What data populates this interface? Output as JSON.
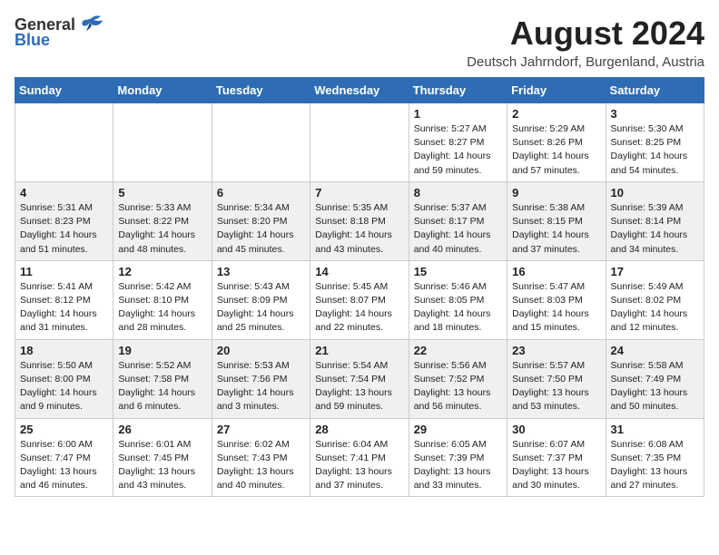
{
  "header": {
    "logo_general": "General",
    "logo_blue": "Blue",
    "month_year": "August 2024",
    "location": "Deutsch Jahrndorf, Burgenland, Austria"
  },
  "days_of_week": [
    "Sunday",
    "Monday",
    "Tuesday",
    "Wednesday",
    "Thursday",
    "Friday",
    "Saturday"
  ],
  "weeks": [
    [
      {
        "day": "",
        "detail": ""
      },
      {
        "day": "",
        "detail": ""
      },
      {
        "day": "",
        "detail": ""
      },
      {
        "day": "",
        "detail": ""
      },
      {
        "day": "1",
        "detail": "Sunrise: 5:27 AM\nSunset: 8:27 PM\nDaylight: 14 hours\nand 59 minutes."
      },
      {
        "day": "2",
        "detail": "Sunrise: 5:29 AM\nSunset: 8:26 PM\nDaylight: 14 hours\nand 57 minutes."
      },
      {
        "day": "3",
        "detail": "Sunrise: 5:30 AM\nSunset: 8:25 PM\nDaylight: 14 hours\nand 54 minutes."
      }
    ],
    [
      {
        "day": "4",
        "detail": "Sunrise: 5:31 AM\nSunset: 8:23 PM\nDaylight: 14 hours\nand 51 minutes."
      },
      {
        "day": "5",
        "detail": "Sunrise: 5:33 AM\nSunset: 8:22 PM\nDaylight: 14 hours\nand 48 minutes."
      },
      {
        "day": "6",
        "detail": "Sunrise: 5:34 AM\nSunset: 8:20 PM\nDaylight: 14 hours\nand 45 minutes."
      },
      {
        "day": "7",
        "detail": "Sunrise: 5:35 AM\nSunset: 8:18 PM\nDaylight: 14 hours\nand 43 minutes."
      },
      {
        "day": "8",
        "detail": "Sunrise: 5:37 AM\nSunset: 8:17 PM\nDaylight: 14 hours\nand 40 minutes."
      },
      {
        "day": "9",
        "detail": "Sunrise: 5:38 AM\nSunset: 8:15 PM\nDaylight: 14 hours\nand 37 minutes."
      },
      {
        "day": "10",
        "detail": "Sunrise: 5:39 AM\nSunset: 8:14 PM\nDaylight: 14 hours\nand 34 minutes."
      }
    ],
    [
      {
        "day": "11",
        "detail": "Sunrise: 5:41 AM\nSunset: 8:12 PM\nDaylight: 14 hours\nand 31 minutes."
      },
      {
        "day": "12",
        "detail": "Sunrise: 5:42 AM\nSunset: 8:10 PM\nDaylight: 14 hours\nand 28 minutes."
      },
      {
        "day": "13",
        "detail": "Sunrise: 5:43 AM\nSunset: 8:09 PM\nDaylight: 14 hours\nand 25 minutes."
      },
      {
        "day": "14",
        "detail": "Sunrise: 5:45 AM\nSunset: 8:07 PM\nDaylight: 14 hours\nand 22 minutes."
      },
      {
        "day": "15",
        "detail": "Sunrise: 5:46 AM\nSunset: 8:05 PM\nDaylight: 14 hours\nand 18 minutes."
      },
      {
        "day": "16",
        "detail": "Sunrise: 5:47 AM\nSunset: 8:03 PM\nDaylight: 14 hours\nand 15 minutes."
      },
      {
        "day": "17",
        "detail": "Sunrise: 5:49 AM\nSunset: 8:02 PM\nDaylight: 14 hours\nand 12 minutes."
      }
    ],
    [
      {
        "day": "18",
        "detail": "Sunrise: 5:50 AM\nSunset: 8:00 PM\nDaylight: 14 hours\nand 9 minutes."
      },
      {
        "day": "19",
        "detail": "Sunrise: 5:52 AM\nSunset: 7:58 PM\nDaylight: 14 hours\nand 6 minutes."
      },
      {
        "day": "20",
        "detail": "Sunrise: 5:53 AM\nSunset: 7:56 PM\nDaylight: 14 hours\nand 3 minutes."
      },
      {
        "day": "21",
        "detail": "Sunrise: 5:54 AM\nSunset: 7:54 PM\nDaylight: 13 hours\nand 59 minutes."
      },
      {
        "day": "22",
        "detail": "Sunrise: 5:56 AM\nSunset: 7:52 PM\nDaylight: 13 hours\nand 56 minutes."
      },
      {
        "day": "23",
        "detail": "Sunrise: 5:57 AM\nSunset: 7:50 PM\nDaylight: 13 hours\nand 53 minutes."
      },
      {
        "day": "24",
        "detail": "Sunrise: 5:58 AM\nSunset: 7:49 PM\nDaylight: 13 hours\nand 50 minutes."
      }
    ],
    [
      {
        "day": "25",
        "detail": "Sunrise: 6:00 AM\nSunset: 7:47 PM\nDaylight: 13 hours\nand 46 minutes."
      },
      {
        "day": "26",
        "detail": "Sunrise: 6:01 AM\nSunset: 7:45 PM\nDaylight: 13 hours\nand 43 minutes."
      },
      {
        "day": "27",
        "detail": "Sunrise: 6:02 AM\nSunset: 7:43 PM\nDaylight: 13 hours\nand 40 minutes."
      },
      {
        "day": "28",
        "detail": "Sunrise: 6:04 AM\nSunset: 7:41 PM\nDaylight: 13 hours\nand 37 minutes."
      },
      {
        "day": "29",
        "detail": "Sunrise: 6:05 AM\nSunset: 7:39 PM\nDaylight: 13 hours\nand 33 minutes."
      },
      {
        "day": "30",
        "detail": "Sunrise: 6:07 AM\nSunset: 7:37 PM\nDaylight: 13 hours\nand 30 minutes."
      },
      {
        "day": "31",
        "detail": "Sunrise: 6:08 AM\nSunset: 7:35 PM\nDaylight: 13 hours\nand 27 minutes."
      }
    ]
  ]
}
